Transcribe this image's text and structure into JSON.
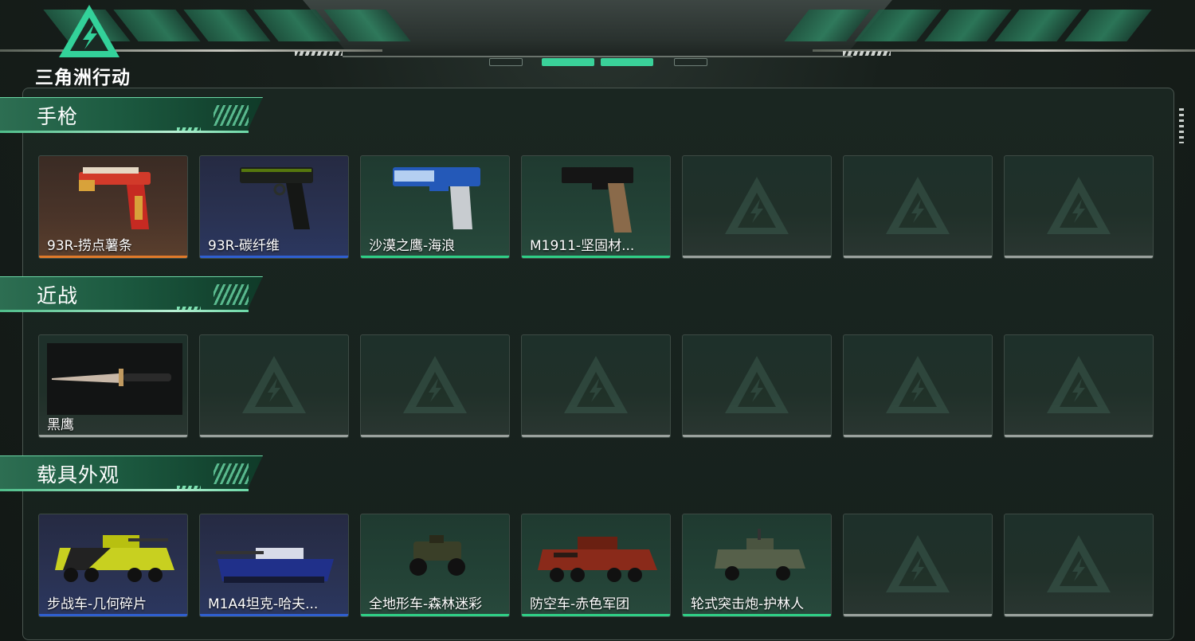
{
  "brand": {
    "name": "三角洲行动",
    "accent": "#3ad199"
  },
  "colors": {
    "orange": "#e07a2a",
    "blue": "#2f5fd0",
    "green": "#2fcf86",
    "empty": "#9aa19d"
  },
  "sections": [
    {
      "title": "手枪",
      "items": [
        {
          "label": "93R-捞点薯条",
          "rarity": "orange",
          "icon": "pistol-gold-red"
        },
        {
          "label": "93R-碳纤维",
          "rarity": "blue",
          "icon": "pistol-carbon"
        },
        {
          "label": "沙漠之鹰-海浪",
          "rarity": "green",
          "icon": "pistol-desert-eagle-wave"
        },
        {
          "label": "M1911-坚固材...",
          "rarity": "green",
          "icon": "pistol-m1911"
        },
        {
          "label": "",
          "rarity": "empty"
        },
        {
          "label": "",
          "rarity": "empty"
        },
        {
          "label": "",
          "rarity": "empty"
        }
      ]
    },
    {
      "title": "近战",
      "items": [
        {
          "label": "黑鹰",
          "rarity": "empty",
          "icon": "knife-black-hawk"
        },
        {
          "label": "",
          "rarity": "empty"
        },
        {
          "label": "",
          "rarity": "empty"
        },
        {
          "label": "",
          "rarity": "empty"
        },
        {
          "label": "",
          "rarity": "empty"
        },
        {
          "label": "",
          "rarity": "empty"
        },
        {
          "label": "",
          "rarity": "empty"
        }
      ]
    },
    {
      "title": "载具外观",
      "items": [
        {
          "label": "步战车-几何碎片",
          "rarity": "blue",
          "icon": "ifv-yellow-geometric"
        },
        {
          "label": "M1A4坦克-哈夫...",
          "rarity": "blue",
          "icon": "tank-m1a4"
        },
        {
          "label": "全地形车-森林迷彩",
          "rarity": "green",
          "icon": "atv-forest-camo"
        },
        {
          "label": "防空车-赤色军团",
          "rarity": "green",
          "icon": "aa-vehicle-red"
        },
        {
          "label": "轮式突击炮-护林人",
          "rarity": "green",
          "icon": "wheeled-assault-gun"
        },
        {
          "label": "",
          "rarity": "empty"
        },
        {
          "label": "",
          "rarity": "empty"
        }
      ]
    }
  ]
}
